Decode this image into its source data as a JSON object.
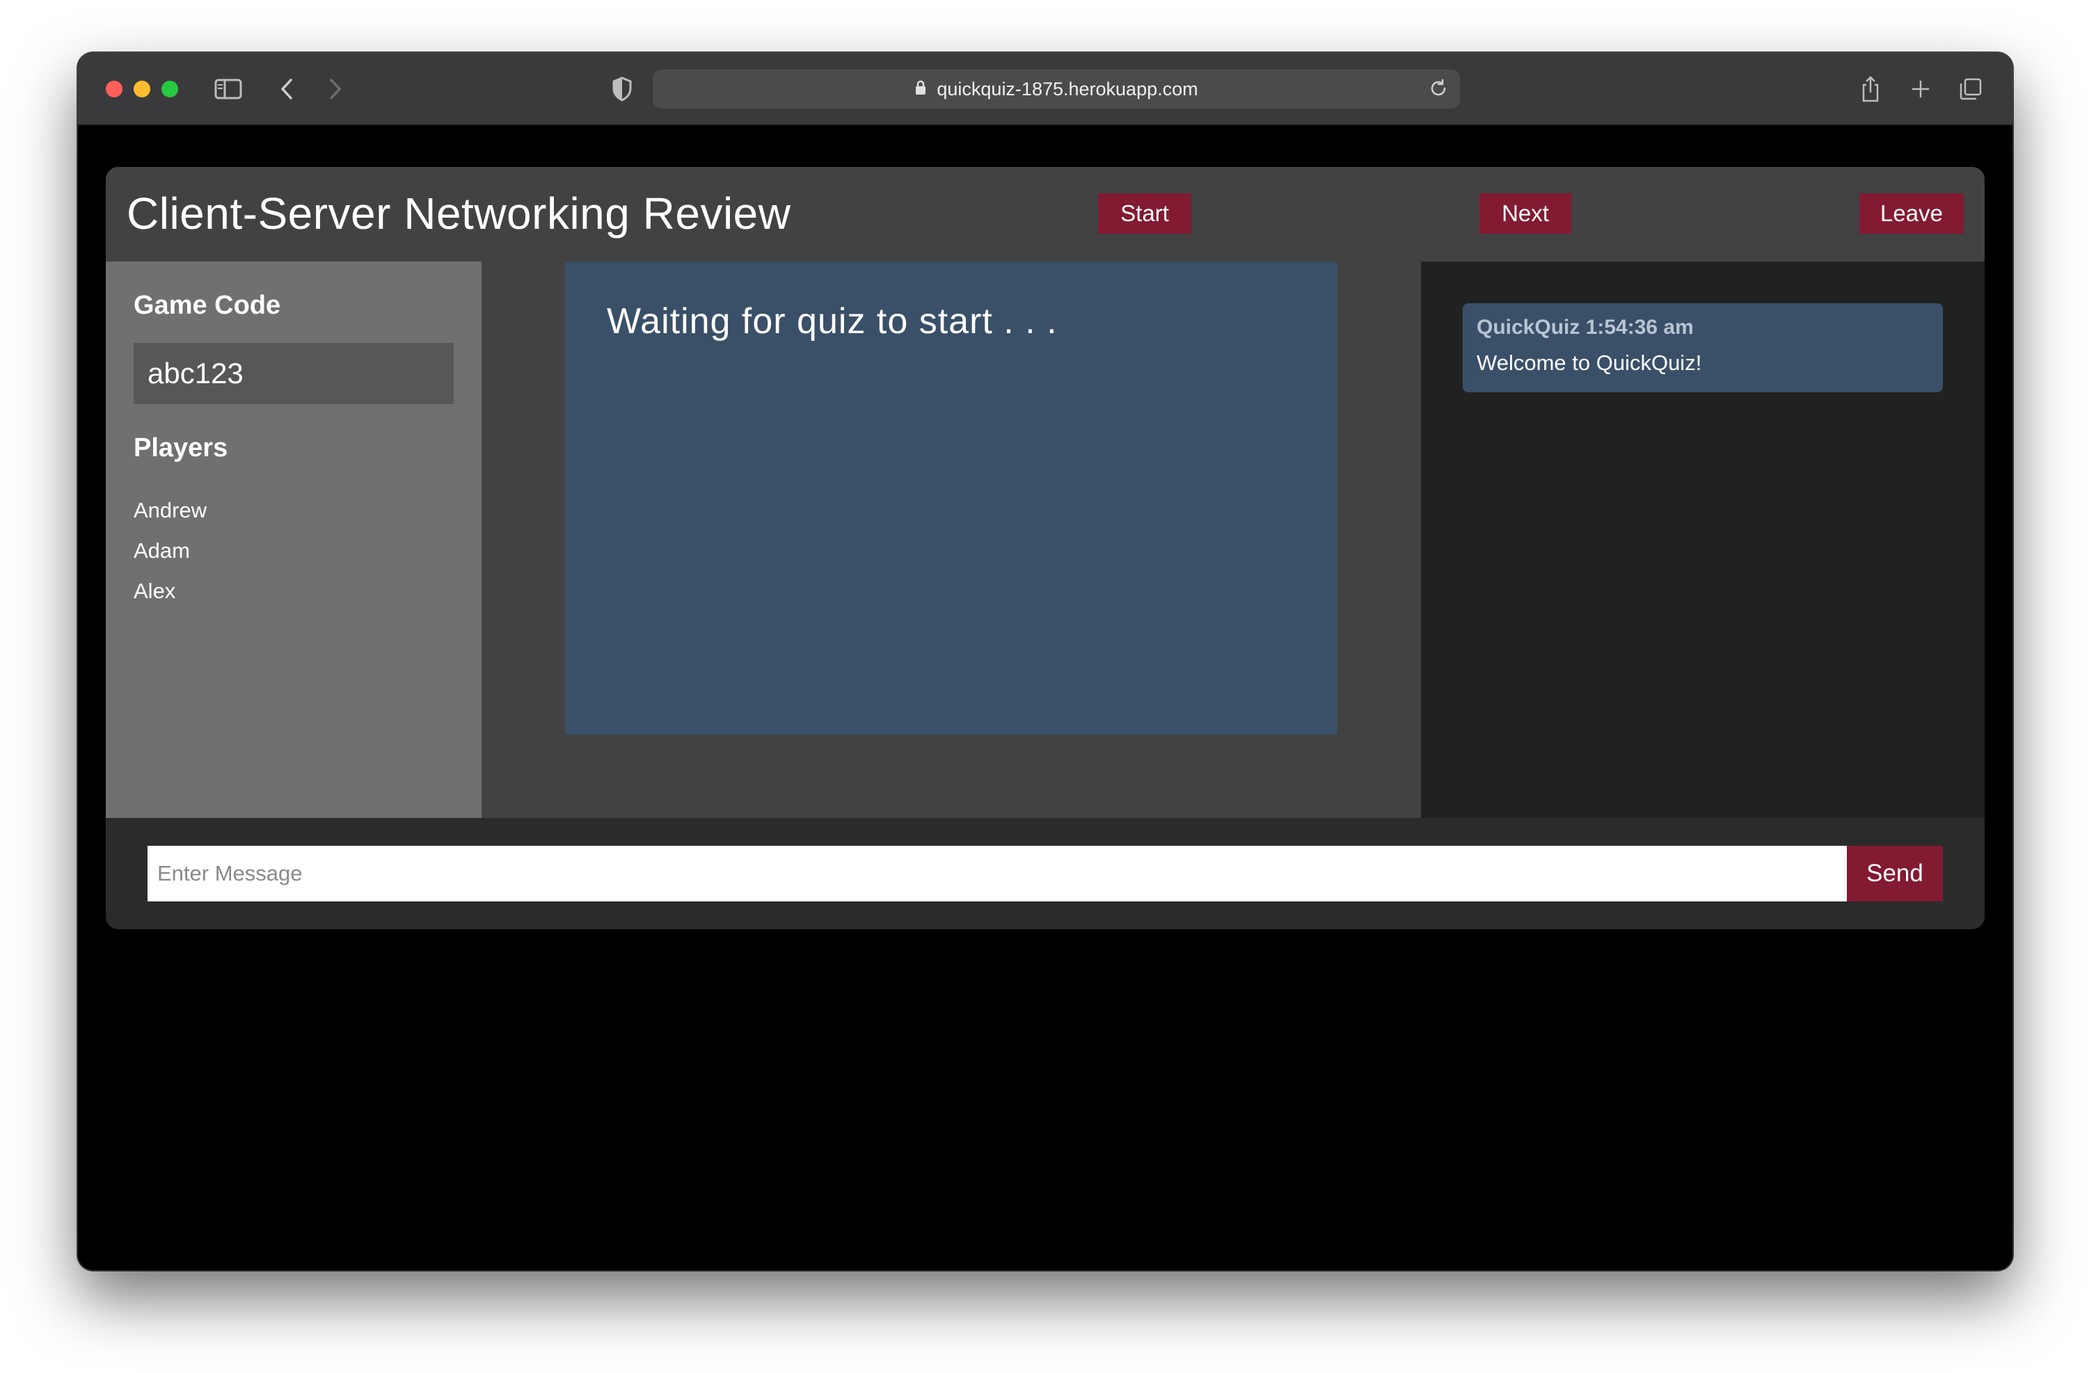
{
  "browser": {
    "url": "quickquiz-1875.herokuapp.com"
  },
  "header": {
    "title": "Client-Server Networking Review",
    "start_label": "Start",
    "next_label": "Next",
    "leave_label": "Leave"
  },
  "sidebar": {
    "game_code_heading": "Game Code",
    "game_code": "abc123",
    "players_heading": "Players",
    "players": [
      "Andrew",
      "Adam",
      "Alex"
    ]
  },
  "main": {
    "status": "Waiting for quiz to start . . ."
  },
  "chat": {
    "messages": [
      {
        "meta": "QuickQuiz 1:54:36 am",
        "text": "Welcome to QuickQuiz!"
      }
    ],
    "input_placeholder": "Enter Message",
    "send_label": "Send"
  }
}
